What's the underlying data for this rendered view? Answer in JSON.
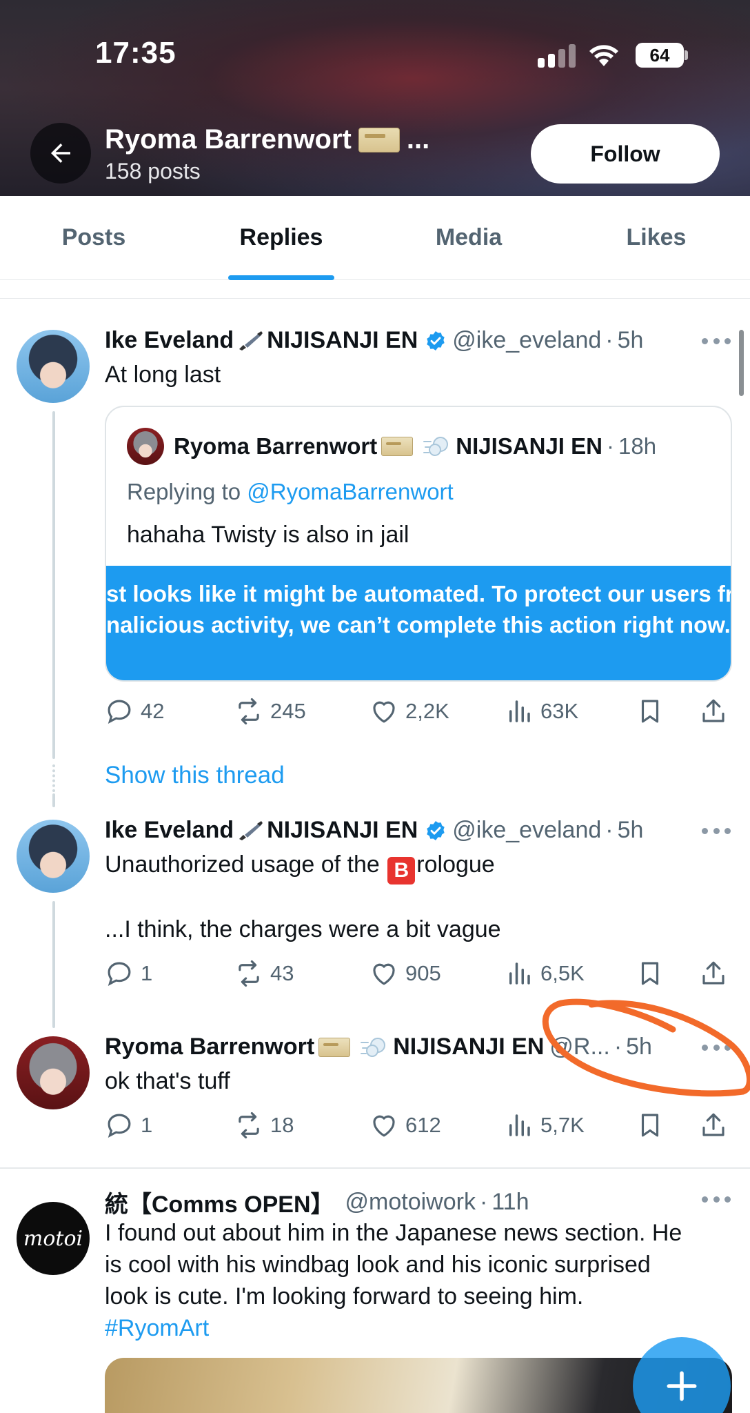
{
  "status_bar": {
    "time": "17:35",
    "battery": "64"
  },
  "profile": {
    "name": "Ryoma Barrenwort",
    "name_ellipsis": "...",
    "posts_count": "158 posts",
    "follow_label": "Follow"
  },
  "tabs": [
    {
      "label": "Posts",
      "active": false
    },
    {
      "label": "Replies",
      "active": true
    },
    {
      "label": "Media",
      "active": false
    },
    {
      "label": "Likes",
      "active": false
    }
  ],
  "posts": [
    {
      "name": "Ike Eveland",
      "org": "NIJISANJI EN",
      "handle": "@ike_eveland",
      "time": "5h",
      "text": "At long last",
      "quote": {
        "name": "Ryoma Barrenwort",
        "org": "NIJISANJI EN",
        "time": "18h",
        "replying_prefix": "Replying to",
        "replying_handle": "@RyomaBarrenwort",
        "text": "hahaha Twisty is also in jail",
        "media_line1": "st looks like it might be automated. To protect our users fro",
        "media_line2": "nalicious activity, we can’t complete this action right now. I"
      },
      "replies": "42",
      "reposts": "245",
      "likes": "2,2K",
      "views": "63K"
    },
    {
      "name": "Ike Eveland",
      "org": "NIJISANJI EN",
      "handle": "@ike_eveland",
      "time": "5h",
      "text_before": "Unauthorized usage of the",
      "text_emoji": "B",
      "text_after": "rologue",
      "text_line2": "...I think, the charges were a bit vague",
      "replies": "1",
      "reposts": "43",
      "likes": "905",
      "views": "6,5K"
    },
    {
      "name": "Ryoma Barrenwort",
      "org": "NIJISANJI EN",
      "handle": "@R...",
      "time": "5h",
      "text": "ok that's tuff",
      "replies": "1",
      "reposts": "18",
      "likes": "612",
      "views": "5,7K"
    },
    {
      "name": "統【Comms OPEN】",
      "handle": "@motoiwork",
      "time": "11h",
      "text_line1": "I found out about him in the Japanese news section. He",
      "text_line2": "is cool with his windbag look and his iconic surprised",
      "text_line3": "look is cute. I'm looking forward to seeing him.",
      "hashtag": "#RyomArt",
      "avatar_text": "motoi"
    }
  ],
  "show_thread_label": "Show this thread",
  "dot_separator": "·",
  "colors": {
    "accent": "#1d9bf0",
    "text_primary": "#0f1419",
    "text_secondary": "#536471",
    "annotation": "#f26a2a"
  }
}
